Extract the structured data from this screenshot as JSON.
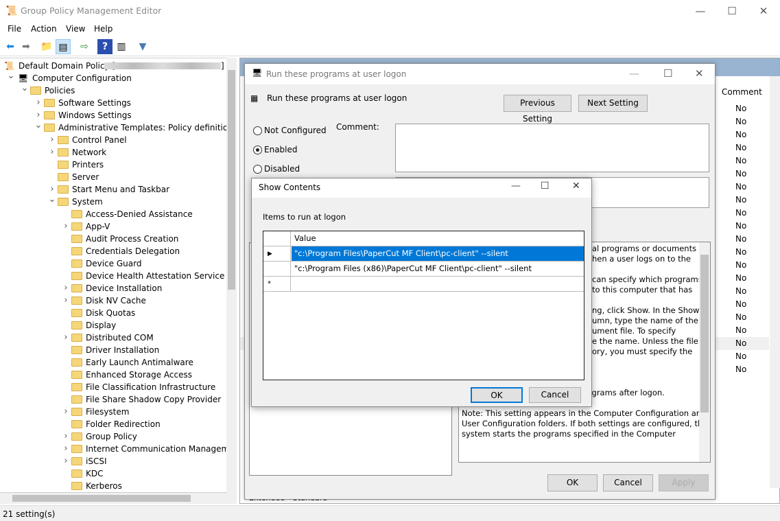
{
  "window": {
    "title": "Group Policy Management Editor"
  },
  "menu": [
    "File",
    "Action",
    "View",
    "Help"
  ],
  "toolbar_icons": [
    "back-icon",
    "forward-icon",
    "up-folder-icon",
    "show-hide-tree-icon",
    "export-list-icon",
    "help-icon",
    "show-action-pane-icon",
    "filter-icon"
  ],
  "tree": [
    {
      "label": "Default Domain Policy [",
      "level": 0,
      "caret": "",
      "icon": "policy"
    },
    {
      "label": "Computer Configuration",
      "level": 0,
      "caret": "open",
      "icon": "computer"
    },
    {
      "label": "Policies",
      "level": 1,
      "caret": "open",
      "icon": "folder"
    },
    {
      "label": "Software Settings",
      "level": 2,
      "caret": "closed",
      "icon": "folder"
    },
    {
      "label": "Windows Settings",
      "level": 2,
      "caret": "closed",
      "icon": "folder"
    },
    {
      "label": "Administrative Templates: Policy definitions (A",
      "level": 2,
      "caret": "open",
      "icon": "folder"
    },
    {
      "label": "Control Panel",
      "level": 3,
      "caret": "closed",
      "icon": "folder"
    },
    {
      "label": "Network",
      "level": 3,
      "caret": "closed",
      "icon": "folder"
    },
    {
      "label": "Printers",
      "level": 3,
      "caret": "",
      "icon": "folder"
    },
    {
      "label": "Server",
      "level": 3,
      "caret": "",
      "icon": "folder"
    },
    {
      "label": "Start Menu and Taskbar",
      "level": 3,
      "caret": "closed",
      "icon": "folder"
    },
    {
      "label": "System",
      "level": 3,
      "caret": "open",
      "icon": "folder"
    },
    {
      "label": "Access-Denied Assistance",
      "level": 4,
      "caret": "",
      "icon": "folder"
    },
    {
      "label": "App-V",
      "level": 4,
      "caret": "closed",
      "icon": "folder"
    },
    {
      "label": "Audit Process Creation",
      "level": 4,
      "caret": "",
      "icon": "folder"
    },
    {
      "label": "Credentials Delegation",
      "level": 4,
      "caret": "",
      "icon": "folder"
    },
    {
      "label": "Device Guard",
      "level": 4,
      "caret": "",
      "icon": "folder"
    },
    {
      "label": "Device Health Attestation Service",
      "level": 4,
      "caret": "",
      "icon": "folder"
    },
    {
      "label": "Device Installation",
      "level": 4,
      "caret": "closed",
      "icon": "folder"
    },
    {
      "label": "Disk NV Cache",
      "level": 4,
      "caret": "closed",
      "icon": "folder"
    },
    {
      "label": "Disk Quotas",
      "level": 4,
      "caret": "",
      "icon": "folder"
    },
    {
      "label": "Display",
      "level": 4,
      "caret": "",
      "icon": "folder"
    },
    {
      "label": "Distributed COM",
      "level": 4,
      "caret": "closed",
      "icon": "folder"
    },
    {
      "label": "Driver Installation",
      "level": 4,
      "caret": "",
      "icon": "folder"
    },
    {
      "label": "Early Launch Antimalware",
      "level": 4,
      "caret": "",
      "icon": "folder"
    },
    {
      "label": "Enhanced Storage Access",
      "level": 4,
      "caret": "",
      "icon": "folder"
    },
    {
      "label": "File Classification Infrastructure",
      "level": 4,
      "caret": "",
      "icon": "folder"
    },
    {
      "label": "File Share Shadow Copy Provider",
      "level": 4,
      "caret": "",
      "icon": "folder"
    },
    {
      "label": "Filesystem",
      "level": 4,
      "caret": "closed",
      "icon": "folder"
    },
    {
      "label": "Folder Redirection",
      "level": 4,
      "caret": "",
      "icon": "folder"
    },
    {
      "label": "Group Policy",
      "level": 4,
      "caret": "closed",
      "icon": "folder"
    },
    {
      "label": "Internet Communication Management",
      "level": 4,
      "caret": "closed",
      "icon": "folder"
    },
    {
      "label": "iSCSI",
      "level": 4,
      "caret": "closed",
      "icon": "folder"
    },
    {
      "label": "KDC",
      "level": 4,
      "caret": "",
      "icon": "folder"
    },
    {
      "label": "Kerberos",
      "level": 4,
      "caret": "",
      "icon": "folder"
    }
  ],
  "list": {
    "comment_header": "Comment",
    "comments": [
      "No",
      "No",
      "No",
      "No",
      "No",
      "No",
      "No",
      "No",
      "No",
      "No",
      "No",
      "No",
      "No",
      "No",
      "No",
      "No",
      "No",
      "No",
      "No",
      "No",
      "No"
    ]
  },
  "tabs": [
    "Extended",
    "Standard"
  ],
  "status": "21 setting(s)",
  "policy_dialog": {
    "title": "Run these programs at user logon",
    "heading": "Run these programs at user logon",
    "prev": "Previous Setting",
    "next": "Next Setting",
    "options": [
      "Not Configured",
      "Enabled",
      "Disabled"
    ],
    "selected": "Enabled",
    "comment_label": "Comment:",
    "help_lines": [
      "al programs or documents",
      "hen a user logs on to the",
      "",
      "can specify which programs",
      "to this computer that has",
      "",
      "ng, click Show. In the Show",
      "umn, type the name of the",
      "ument file. To specify",
      "e the name. Unless the file is",
      "ory, you must specify the",
      "",
      "",
      "is policy setting, the user will",
      "have to start the appropriate programs after logon.",
      "",
      "Note: This setting appears in the Computer Configuration and",
      "User Configuration folders. If both settings are configured, the",
      "system starts the programs specified in the Computer"
    ],
    "ok": "OK",
    "cancel": "Cancel",
    "apply": "Apply"
  },
  "show_contents": {
    "title": "Show Contents",
    "label": "Items to run at logon",
    "column": "Value",
    "rows": [
      "\"c:\\Program Files\\PaperCut MF Client\\pc-client\" --silent",
      "\"c:\\Program Files (x86)\\PaperCut MF Client\\pc-client\" --silent"
    ],
    "new_row_marker": "*",
    "ok": "OK",
    "cancel": "Cancel"
  },
  "colors": {
    "selection": "#0078d7",
    "header_band": "#99b4d1"
  }
}
